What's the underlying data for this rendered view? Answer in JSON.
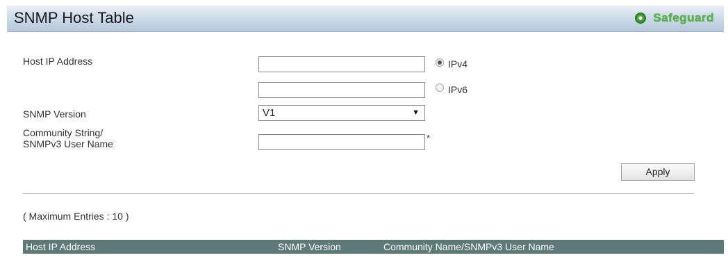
{
  "header": {
    "title": "SNMP Host Table",
    "safeguard_label": "Safeguard"
  },
  "form": {
    "host_ip_label": "Host IP Address",
    "ipv4_value": "",
    "ipv4_label": "IPv4",
    "ipv6_value": "",
    "ipv6_label": "IPv6",
    "selected_ip_type": "IPv4",
    "snmp_version_label": "SNMP Version",
    "snmp_version_selected": "V1",
    "community_label_line1": "Community String/",
    "community_label_line2": "SNMPv3 User Name",
    "community_value": "",
    "required_marker": "*",
    "apply_label": "Apply"
  },
  "max_entries_text": "( Maximum Entries : 10 )",
  "table": {
    "columns": [
      "Host IP Address",
      "SNMP Version",
      "Community Name/SNMPv3 User Name"
    ],
    "rows": []
  },
  "colors": {
    "header_bar": "#c9d8e6",
    "table_header": "#5e7a78",
    "safeguard_green": "#58b748"
  },
  "icons": {
    "safeguard": "safeguard-status-icon",
    "dropdown": "chevron-down-icon"
  }
}
